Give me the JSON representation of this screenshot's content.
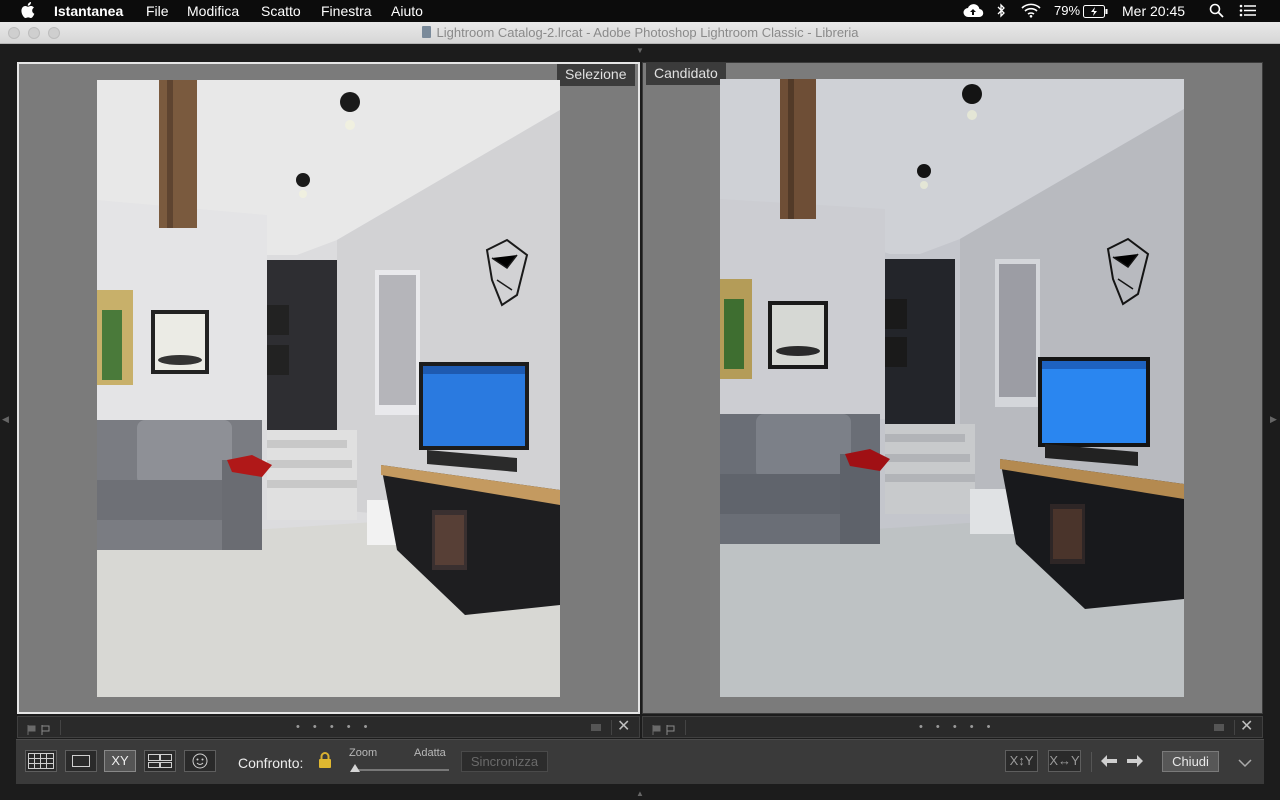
{
  "menubar": {
    "app_name": "Istantanea",
    "items": [
      "File",
      "Modifica",
      "Scatto",
      "Finestra",
      "Aiuto"
    ],
    "battery": "79%",
    "clock": "Mer 20:45"
  },
  "window": {
    "title": "Lightroom Catalog-2.lrcat - Adobe Photoshop Lightroom Classic - Libreria"
  },
  "compare": {
    "select_label": "Selezione",
    "candidate_label": "Candidato",
    "infobar_dots": "• • • • •"
  },
  "toolbar": {
    "compare_label": "Confronto:",
    "zoom_label": "Zoom",
    "fit_label": "Adatta",
    "zoom_level": 0,
    "sync_label": "Sincronizza",
    "xy_label": "XY",
    "swap_label": "X↔Y",
    "make_select_label": "X↕Y",
    "close_label": "Chiudi"
  },
  "icons": {
    "apple": "apple-logo-icon",
    "cloud": "cloud-upload-icon",
    "bluetooth": "bluetooth-icon",
    "wifi": "wifi-icon",
    "battery": "battery-charging-icon",
    "search": "search-icon",
    "list": "notification-list-icon"
  }
}
